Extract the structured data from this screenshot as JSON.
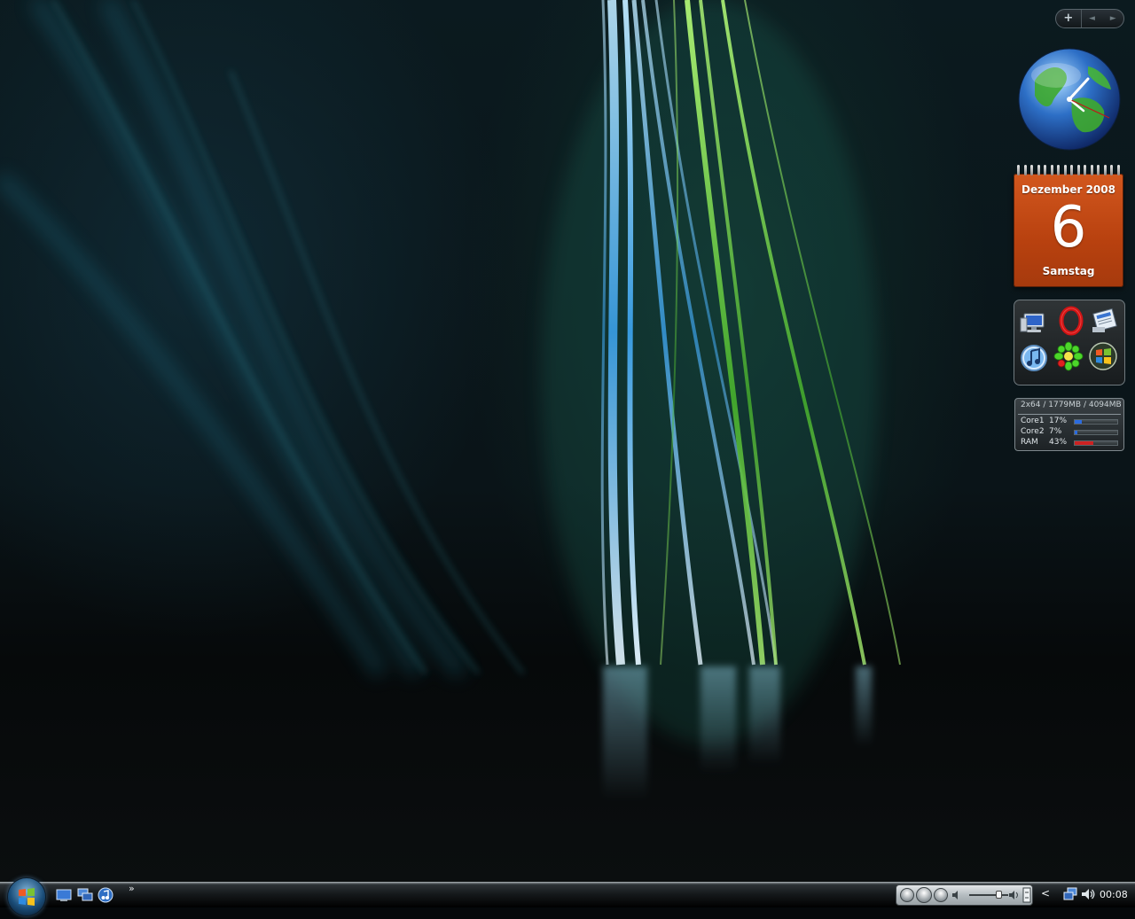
{
  "sidebar": {
    "add_label": "+",
    "prev_label": "◄",
    "next_label": "►"
  },
  "calendar": {
    "month_year": "Dezember 2008",
    "day": "6",
    "weekday": "Samstag",
    "color": "#c24a14"
  },
  "launcher": {
    "items": [
      {
        "icon": "computer-icon"
      },
      {
        "icon": "opera-icon"
      },
      {
        "icon": "notepad-icon"
      },
      {
        "icon": "itunes-icon"
      },
      {
        "icon": "icq-icon"
      },
      {
        "icon": "windows-logo-icon"
      }
    ]
  },
  "sysmon": {
    "header": "2x64 / 1779MB / 4094MB",
    "rows": [
      {
        "name": "Core1",
        "value": "17%",
        "fraction": 0.17,
        "color": "#2a6be0"
      },
      {
        "name": "Core2",
        "value": "7%",
        "fraction": 0.07,
        "color": "#2a6be0"
      },
      {
        "name": "RAM",
        "value": "43%",
        "fraction": 0.43,
        "color": "#cc2222"
      }
    ]
  },
  "taskbar": {
    "more_label": "»",
    "expand_label": "<",
    "clock": "00:08"
  },
  "colors": {
    "accent_blue": "#3aa0e8",
    "accent_green": "#6fd84a"
  }
}
